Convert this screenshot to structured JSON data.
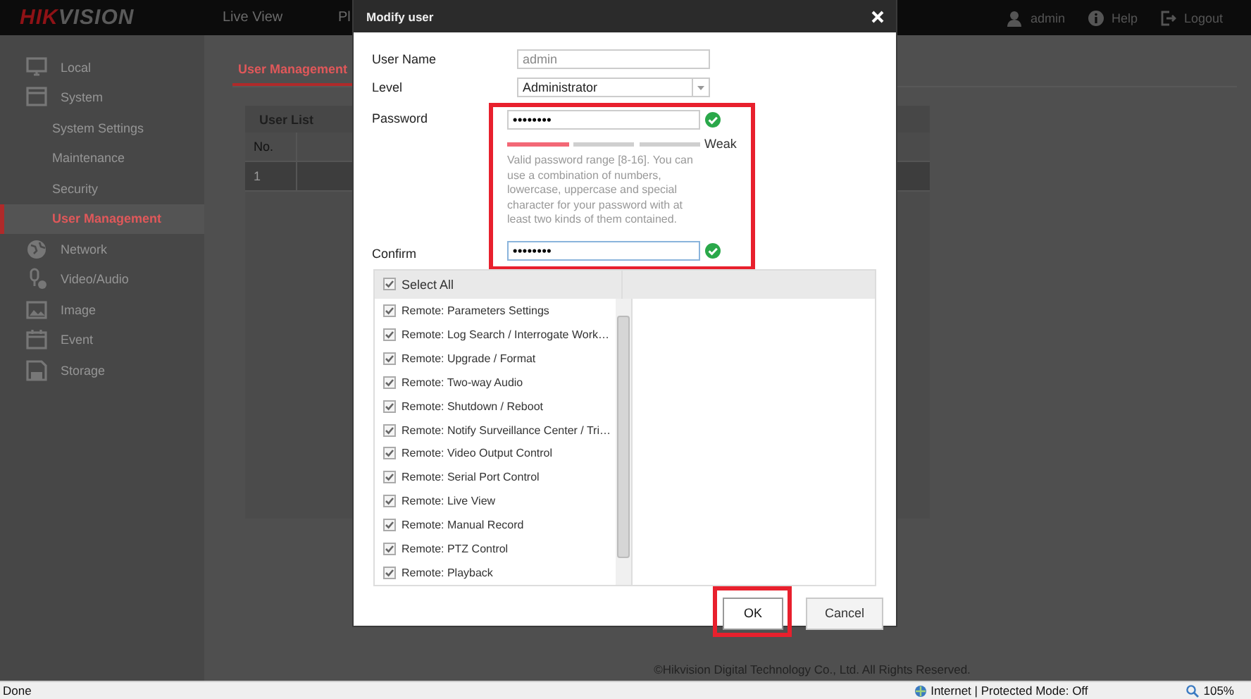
{
  "header": {
    "logo": [
      {
        "text": "HIK",
        "color": "#8f1216"
      },
      {
        "text": "VISION",
        "color": "#5a5a5a"
      }
    ],
    "nav": [
      {
        "label": "Live View"
      },
      {
        "label": "Pl"
      }
    ],
    "user_menu": [
      {
        "kind": "user",
        "label": "admin"
      },
      {
        "kind": "help",
        "label": "Help"
      },
      {
        "kind": "logout",
        "label": "Logout"
      }
    ]
  },
  "sidebar": {
    "items": [
      {
        "kind": "monitor",
        "label": "Local",
        "selected": false
      },
      {
        "kind": "window",
        "label": "System",
        "selected": false,
        "expanded": true,
        "children": [
          {
            "label": "System Settings",
            "selected": false
          },
          {
            "label": "Maintenance",
            "selected": false
          },
          {
            "label": "Security",
            "selected": false
          },
          {
            "label": "User Management",
            "selected": true
          }
        ]
      },
      {
        "kind": "globe",
        "label": "Network",
        "selected": false
      },
      {
        "kind": "mic",
        "label": "Video/Audio",
        "selected": false
      },
      {
        "kind": "image",
        "label": "Image",
        "selected": false
      },
      {
        "kind": "calendar",
        "label": "Event",
        "selected": false
      },
      {
        "kind": "disk",
        "label": "Storage",
        "selected": false
      }
    ]
  },
  "content": {
    "tabs": [
      {
        "label": "User Management",
        "selected": true
      }
    ],
    "user_list": {
      "title": "User List",
      "columns": [
        "No."
      ],
      "rows": [
        {
          "cells": [
            "1"
          ],
          "selected": true
        }
      ]
    },
    "footer": "©Hikvision Digital Technology Co., Ltd. All Rights Reserved."
  },
  "dialog": {
    "title": "Modify user",
    "fields": [
      {
        "kind": "text",
        "label": "User Name",
        "value": "admin",
        "disabled": true
      },
      {
        "kind": "select",
        "label": "Level",
        "value": "Administrator",
        "disabled": false
      }
    ],
    "password": {
      "highlighted": true,
      "label": "Password",
      "value": "••••••••",
      "valid": true,
      "strength": {
        "level": 0.333,
        "label": "Weak"
      },
      "hint": "Valid password range [8-16]. You can use a combination of numbers, lowercase, uppercase and special character for your password with at least two kinds of them contained.",
      "confirm_label": "Confirm",
      "confirm_value": "••••••••",
      "confirm_valid": true
    },
    "permissions": {
      "select_all": {
        "label": "Select All",
        "checked": true,
        "disabled": true
      },
      "items": [
        {
          "label": "Remote: Parameters Settings",
          "checked": true,
          "disabled": true
        },
        {
          "label": "Remote: Log Search / Interrogate Work…",
          "checked": true,
          "disabled": true
        },
        {
          "label": "Remote: Upgrade / Format",
          "checked": true,
          "disabled": true
        },
        {
          "label": "Remote: Two-way Audio",
          "checked": true,
          "disabled": true
        },
        {
          "label": "Remote: Shutdown / Reboot",
          "checked": true,
          "disabled": true
        },
        {
          "label": "Remote: Notify Surveillance Center / Tri…",
          "checked": true,
          "disabled": true
        },
        {
          "label": "Remote: Video Output Control",
          "checked": true,
          "disabled": true
        },
        {
          "label": "Remote: Serial Port Control",
          "checked": true,
          "disabled": true
        },
        {
          "label": "Remote: Live View",
          "checked": true,
          "disabled": true
        },
        {
          "label": "Remote: Manual Record",
          "checked": true,
          "disabled": true
        },
        {
          "label": "Remote: PTZ Control",
          "checked": true,
          "disabled": true
        },
        {
          "label": "Remote: Playback",
          "checked": true,
          "disabled": true
        }
      ]
    },
    "buttons": [
      {
        "kind": "ok",
        "label": "OK",
        "highlighted": true
      },
      {
        "kind": "cancel",
        "label": "Cancel",
        "highlighted": false
      }
    ]
  },
  "status_bar": {
    "status": "Done",
    "zone": "Internet | Protected Mode: Off",
    "zoom": "105%"
  }
}
